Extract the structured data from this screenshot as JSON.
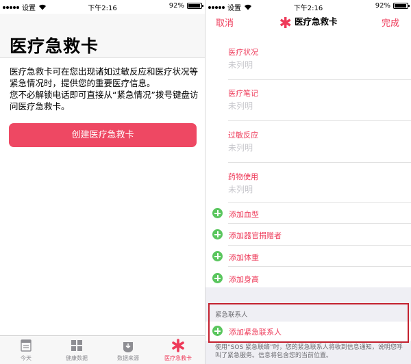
{
  "left": {
    "status_bar": {
      "carrier": "设置",
      "time": "下午2:16",
      "battery": "92%",
      "battery_level": 0.92
    },
    "title": "医疗急救卡",
    "description_line1": "医疗急救卡可在您出现诸如过敏反应和医疗状况等紧急情况时，提供您的重要医疗信息。",
    "description_line2": "您不必解锁电话即可直接从“紧急情况”拨号键盘访问医疗急救卡。",
    "create_button": "创建医疗急救卡",
    "tabs": [
      {
        "label": "今天",
        "icon": "today-icon"
      },
      {
        "label": "健康数据",
        "icon": "health-data-icon"
      },
      {
        "label": "数据来源",
        "icon": "sources-icon"
      },
      {
        "label": "医疗急救卡",
        "icon": "medical-id-icon",
        "active": true
      }
    ]
  },
  "right": {
    "status_bar": {
      "carrier": "设置",
      "time": "下午2:16",
      "battery": "92%",
      "battery_level": 0.92
    },
    "nav": {
      "cancel": "取消",
      "title": "医疗急救卡",
      "done": "完成"
    },
    "fields": [
      {
        "label": "医疗状况",
        "value": "未列明"
      },
      {
        "label": "医疗笔记",
        "value": "未列明"
      },
      {
        "label": "过敏反应",
        "value": "未列明"
      },
      {
        "label": "药物使用",
        "value": "未列明"
      }
    ],
    "add_rows": [
      "添加血型",
      "添加器官捐赠者",
      "添加体重",
      "添加身高"
    ],
    "emergency": {
      "header": "紧急联系人",
      "add_contact": "添加紧急联系人",
      "footer": "使用“SOS 紧急联络”时，您的紧急联系人将收到信息通知，说明您呼叫了紧急服务。信息将包含您的当前位置。"
    }
  },
  "colors": {
    "accent": "#ee3b5a",
    "button": "#ee4863",
    "plus": "#5ac65e",
    "highlight": "#c4212f"
  }
}
